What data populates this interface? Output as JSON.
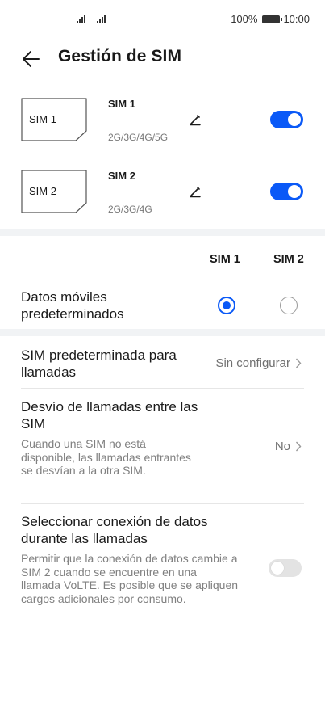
{
  "status": {
    "battery": "100%",
    "time": "10:00"
  },
  "header": {
    "title": "Gestión de SIM"
  },
  "sims": [
    {
      "card_label": "SIM 1",
      "name": "SIM 1",
      "bands": "2G/3G/4G/5G",
      "enabled": true
    },
    {
      "card_label": "SIM 2",
      "name": "SIM 2",
      "bands": "2G/3G/4G",
      "enabled": true
    }
  ],
  "columns": {
    "sim1": "SIM 1",
    "sim2": "SIM 2"
  },
  "mobile_data": {
    "label": "Datos móviles predeterminados",
    "selected": "SIM 1"
  },
  "default_calls": {
    "title": "SIM predeterminada para llamadas",
    "value": "Sin configurar"
  },
  "call_forwarding": {
    "title": "Desvío de llamadas entre las SIM",
    "description": "Cuando una SIM no está disponible, las llamadas entrantes se desvían a la otra SIM.",
    "value": "No"
  },
  "data_during_calls": {
    "title": "Seleccionar conexión de datos durante las llamadas",
    "description": "Permitir que la conexión de datos cambie a SIM 2 cuando se encuentre en una llamada VoLTE. Es posible que se apliquen cargos adicionales por consumo.",
    "enabled": false
  },
  "colors": {
    "accent": "#0a59f7",
    "band": "#f1f3f5"
  },
  "icons": [
    "signal-icon",
    "battery-icon",
    "back-arrow-icon",
    "sim-card-icon",
    "edit-pencil-icon",
    "chevron-right-icon"
  ]
}
